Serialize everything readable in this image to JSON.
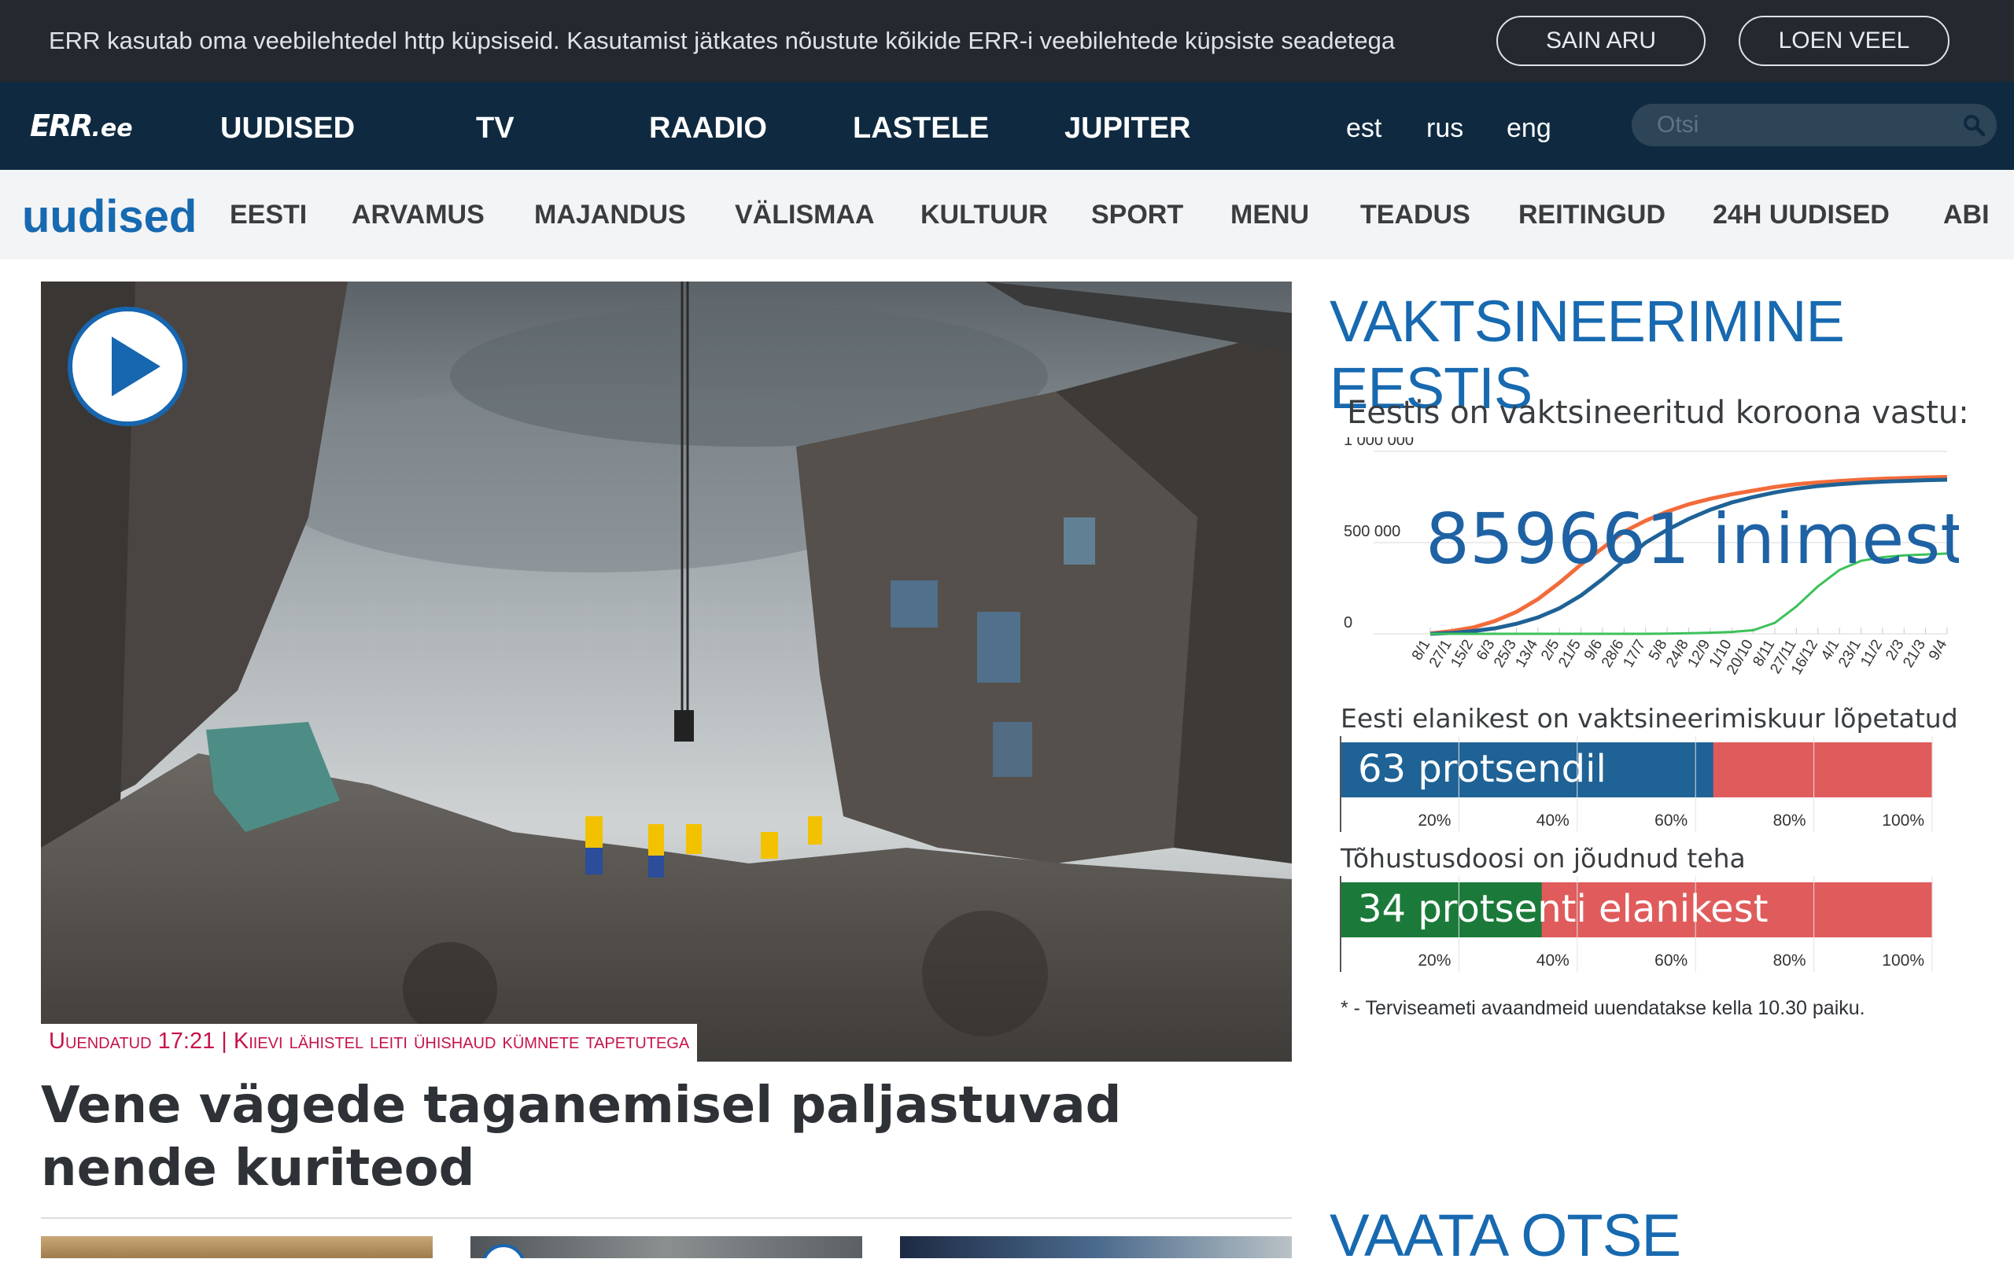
{
  "cookie": {
    "text": "ERR kasutab oma veebilehtedel http küpsiseid. Kasutamist jätkates nõustute kõikide ERR-i veebilehtede küpsiste seadetega",
    "accept_label": "SAIN ARU",
    "more_label": "LOEN VEEL"
  },
  "main_nav": {
    "logo_err": "ERR",
    "logo_ee": ".ee",
    "items": [
      "UUDISED",
      "TV",
      "RAADIO",
      "LASTELE",
      "JUPITER"
    ],
    "languages": [
      "est",
      "rus",
      "eng"
    ],
    "search_placeholder": "Otsi",
    "search_icon": "search-icon"
  },
  "section_nav": {
    "title": "uudised",
    "items": [
      "EESTI",
      "ARVAMUS",
      "MAJANDUS",
      "VÄLISMAA",
      "KULTUUR",
      "SPORT",
      "MENU",
      "TEADUS",
      "REITINGUD",
      "24H UUDISED",
      "ABI"
    ]
  },
  "hero": {
    "caption": "Uuendatud 17:21 | Kiievi lähistel leiti ühishaud kümnete tapetutega",
    "headline": "Vene vägede taganemisel paljastuvad nende kuriteod",
    "play_icon": "play-icon"
  },
  "vaccination": {
    "title": "VAKTSINEERIMINE EESTIS",
    "subtitle": "Eestis on vaktsineeritud koroona vastu:",
    "total_text": "859661 inimest",
    "bar1_label": "Eesti elanikest on vaktsineerimiskuur lõpetatud",
    "bar1_text": "63 protsendil",
    "bar1_value": 63,
    "bar2_label": "Tõhustusdoosi on jõudnud teha",
    "bar2_text": "34 protsenti elanikest",
    "bar2_value": 34,
    "bar_ticks": [
      "20%",
      "40%",
      "60%",
      "80%",
      "100%"
    ],
    "footnote": "* - Terviseameti avaandmeid uuendatakse kella 10.30 paiku.",
    "colors": {
      "blue": "#1f6296",
      "red": "#e05c5c",
      "green": "#1b7a3a",
      "orange": "#f26b3a",
      "lightgreen": "#3cc15a",
      "title": "#1769b0"
    }
  },
  "chart_data": {
    "type": "line",
    "title": "Eestis on vaktsineeritud koroona vastu:",
    "annotation": "859661 inimest",
    "x": [
      "8/1",
      "27/1",
      "15/2",
      "6/3",
      "25/3",
      "13/4",
      "2/5",
      "21/5",
      "9/6",
      "28/6",
      "17/7",
      "5/8",
      "24/8",
      "12/9",
      "1/10",
      "20/10",
      "8/11",
      "27/11",
      "16/12",
      "4/1",
      "23/1",
      "11/2",
      "2/3",
      "21/3",
      "9/4"
    ],
    "ylim": [
      0,
      1000000
    ],
    "yticks": [
      "0",
      "500 000",
      "1 000 000"
    ],
    "series": [
      {
        "values": [
          2000,
          15000,
          35000,
          70000,
          120000,
          190000,
          280000,
          380000,
          470000,
          560000,
          620000,
          670000,
          710000,
          740000,
          765000,
          785000,
          805000,
          820000,
          830000,
          838000,
          845000,
          850000,
          854000,
          857000,
          859661
        ]
      },
      {
        "values": [
          0,
          5000,
          15000,
          30000,
          55000,
          90000,
          140000,
          210000,
          300000,
          400000,
          500000,
          570000,
          630000,
          680000,
          720000,
          750000,
          775000,
          795000,
          810000,
          820000,
          828000,
          834000,
          838000,
          842000,
          845000
        ]
      },
      {
        "values": [
          0,
          0,
          0,
          0,
          0,
          0,
          0,
          0,
          0,
          0,
          0,
          1000,
          3000,
          6000,
          10000,
          20000,
          60000,
          150000,
          260000,
          350000,
          400000,
          420000,
          430000,
          435000,
          440000
        ]
      }
    ]
  },
  "live": {
    "title": "VAATA OTSE"
  }
}
